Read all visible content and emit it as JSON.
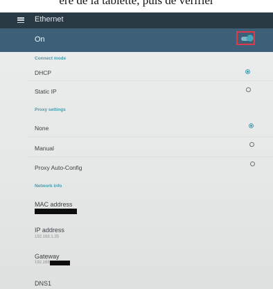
{
  "caption": "ère de la tablette, puis de vérifier",
  "appbar": {
    "menu_icon": "hamburger-icon",
    "title": "Ethernet"
  },
  "master_toggle": {
    "label": "On",
    "state": true
  },
  "connect_mode": {
    "header": "Connect mode",
    "options": [
      {
        "label": "DHCP",
        "selected": true
      },
      {
        "label": "Static IP",
        "selected": false
      }
    ]
  },
  "proxy_settings": {
    "header": "Proxy settings",
    "options": [
      {
        "label": "None",
        "selected": true
      },
      {
        "label": "Manual",
        "selected": false
      },
      {
        "label": "Proxy Auto-Config",
        "selected": false
      }
    ]
  },
  "network_info": {
    "header": "Network info",
    "mac": {
      "title": "MAC address"
    },
    "ip": {
      "title": "IP address",
      "value": "192.168.1.35"
    },
    "gateway": {
      "title": "Gateway",
      "value_prefix": "192.168."
    },
    "dns1": {
      "title": "DNS1"
    }
  },
  "colors": {
    "accent": "#3f9fb2",
    "appbar": "#2a3a44",
    "onbar": "#3d5f78",
    "highlight": "#e0394a"
  }
}
